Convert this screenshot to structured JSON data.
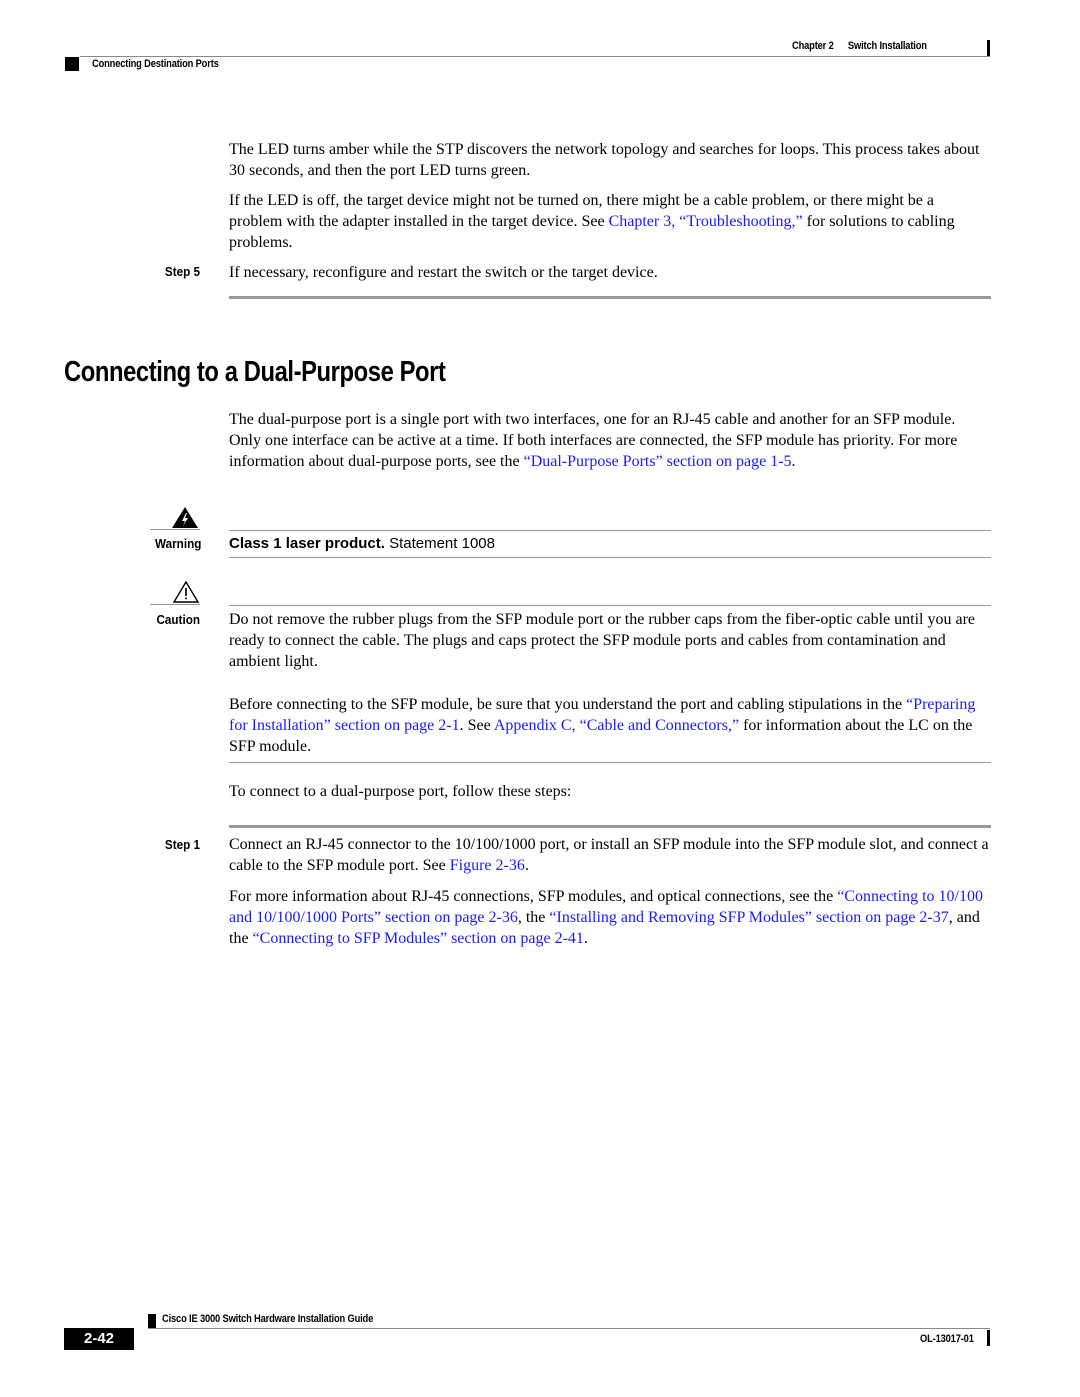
{
  "header": {
    "chapter": "Chapter 2",
    "chapter_title": "Switch Installation",
    "section": "Connecting Destination Ports"
  },
  "intro": {
    "p1": "The LED turns amber while the STP discovers the network topology and searches for loops. This process takes about 30 seconds, and then the port LED turns green.",
    "p2_pre": "If the LED is off, the target device might not be turned on, there might be a cable problem, or there might be a problem with the adapter installed in the target device. See ",
    "p2_link": "Chapter 3, “Troubleshooting,”",
    "p2_post": " for solutions to cabling problems.",
    "step5_label": "Step 5",
    "step5_text": "If necessary, reconfigure and restart the switch or the target device."
  },
  "section": {
    "title": "Connecting to a Dual-Purpose Port",
    "p1_pre": "The dual-purpose port is a single port with two interfaces, one for an RJ-45 cable and another for an SFP module. Only one interface can be active at a time. If both interfaces are connected, the SFP module has priority. For more information about dual-purpose ports, see the ",
    "p1_link": "“Dual-Purpose Ports” section on page 1-5",
    "p1_post": "."
  },
  "warning": {
    "label": "Warning",
    "bold": "Class 1 laser product.",
    "text": " Statement 1008"
  },
  "caution": {
    "label": "Caution",
    "p1": "Do not remove the rubber plugs from the SFP module port or the rubber caps from the fiber-optic cable until you are ready to connect the cable. The plugs and caps protect the SFP module ports and cables from contamination and ambient light.",
    "p2_pre": "Before connecting to the SFP module, be sure that you understand the port and cabling stipulations in the ",
    "p2_link1": "“Preparing for Installation” section on page 2-1",
    "p2_mid": ". See ",
    "p2_link2": "Appendix C, “Cable and Connectors,”",
    "p2_post": " for information about the LC on the SFP module."
  },
  "steps_intro": "To connect to a dual-purpose port, follow these steps:",
  "step1": {
    "label": "Step 1",
    "text_pre": "Connect an RJ-45 connector to the 10/100/1000 port, or install an SFP module into the SFP module slot, and connect a cable to the SFP module port. See ",
    "text_link": "Figure 2-36",
    "text_post": ".",
    "more_pre": "For more information about RJ-45 connections, SFP modules, and optical connections, see the ",
    "more_link1": "“Connecting to 10/100 and 10/100/1000 Ports” section on page 2-36",
    "more_mid1": ", the ",
    "more_link2": "“Installing and Removing SFP Modules” section on page 2-37",
    "more_mid2": ", and the ",
    "more_link3": "“Connecting to SFP Modules” section on page 2-41",
    "more_post": "."
  },
  "footer": {
    "guide_title": "Cisco IE 3000 Switch Hardware Installation Guide",
    "page_number": "2-42",
    "doc_id": "OL-13017-01"
  },
  "colors": {
    "link": "#1a1aff",
    "rule": "#999999"
  }
}
